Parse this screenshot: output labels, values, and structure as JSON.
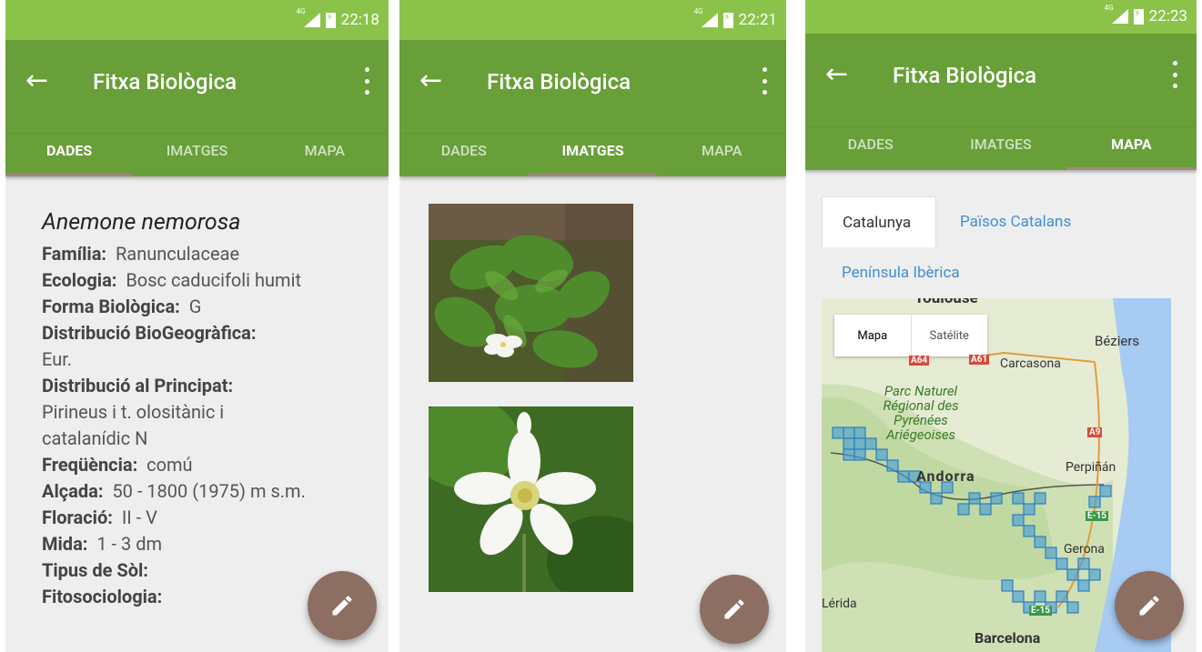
{
  "screens": [
    {
      "status_time": "22:18",
      "title": "Fitxa Biològica",
      "tabs": [
        "DADES",
        "IMATGES",
        "MAPA"
      ],
      "active_tab": 0,
      "species": "Anemone nemorosa",
      "fields": [
        {
          "label": "Família:",
          "value": "Ranunculaceae"
        },
        {
          "label": "Ecologia:",
          "value": "Bosc caducifoli humit"
        },
        {
          "label": "Forma Biològica:",
          "value": "G"
        },
        {
          "label": "Distribució BioGeogràfica:",
          "value": "Eur."
        },
        {
          "label": "Distribució al Principat:",
          "value": "Pirineus i t. olositànic i catalanídic N"
        },
        {
          "label": "Freqüència:",
          "value": "comú"
        },
        {
          "label": "Alçada:",
          "value": "50 - 1800 (1975) m s.m."
        },
        {
          "label": "Floració:",
          "value": "II - V"
        },
        {
          "label": "Mida:",
          "value": "1 - 3 dm"
        },
        {
          "label": "Tipus de Sòl:",
          "value": ""
        },
        {
          "label": "Fitosociologia:",
          "value": ""
        }
      ]
    },
    {
      "status_time": "22:21",
      "title": "Fitxa Biològica",
      "tabs": [
        "DADES",
        "IMATGES",
        "MAPA"
      ],
      "active_tab": 1
    },
    {
      "status_time": "22:23",
      "title": "Fitxa Biològica",
      "tabs": [
        "DADES",
        "IMATGES",
        "MAPA"
      ],
      "active_tab": 2,
      "map_tabs": [
        "Catalunya",
        "Països Catalans",
        "Península Ibèrica"
      ],
      "map_type": [
        "Mapa",
        "Satélite"
      ],
      "map_labels": {
        "toulouse": "Toulouse",
        "beziers": "Béziers",
        "carcasona": "Carcasona",
        "a64": "A64",
        "a61": "A61",
        "a9": "A9",
        "e15a": "E-15",
        "e15b": "E-15",
        "park": "Parc Naturel Régional des Pyrénées Ariégeoises",
        "andorra": "Andorra",
        "perpinan": "Perpiñán",
        "gerona": "Gerona",
        "lerida": "Lérida",
        "barcelona": "Barcelona"
      }
    }
  ],
  "colors": {
    "status": "#8bc34a",
    "toolbar": "#689f38",
    "fab": "#8d6e63",
    "link": "#3f8fd8",
    "sea": "#a7cbf2"
  },
  "icons": [
    "back-arrow-icon",
    "more-vert-icon",
    "edit-pencil-icon",
    "signal-icon",
    "battery-icon"
  ]
}
